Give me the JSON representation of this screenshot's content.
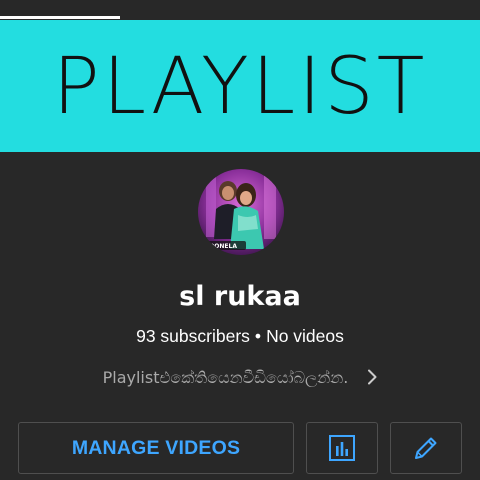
{
  "banner": {
    "text": "PLAYLIST",
    "background": "#23dde0"
  },
  "progress": {
    "value": 0.25
  },
  "channel": {
    "name": "sl rukaa",
    "subscribers": "93 subscribers",
    "separator": "•",
    "videos": "No videos",
    "description": "Playlistඑකේතියෙනවීඩියෝබලන්න.",
    "avatar_icon": "channel-avatar-image"
  },
  "actions": {
    "manage_videos_label": "MANAGE VIDEOS",
    "analytics_icon": "analytics-icon",
    "edit_icon": "edit-pencil-icon"
  },
  "colors": {
    "accent": "#3ea6ff",
    "background": "#282828",
    "secondary_text": "#aaaaaa",
    "border": "#4f4f4f"
  }
}
